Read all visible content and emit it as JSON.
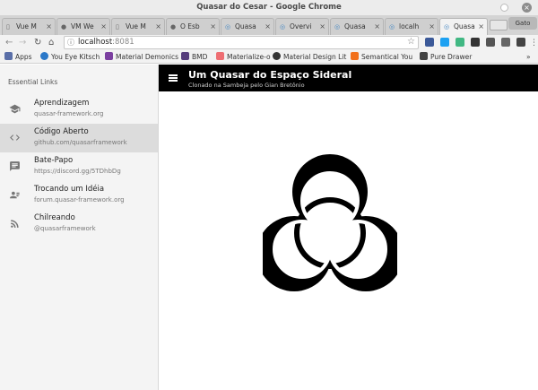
{
  "window": {
    "title": "Quasar do Cesar - Google Chrome",
    "close_glyph": "×"
  },
  "tabs": [
    {
      "label": "Vue M",
      "icon": "page-icon",
      "active": false
    },
    {
      "label": "VM We",
      "icon": "github-icon",
      "active": false
    },
    {
      "label": "Vue M",
      "icon": "page-icon",
      "active": false
    },
    {
      "label": "O Esb",
      "icon": "github-icon",
      "active": false
    },
    {
      "label": "Quasa",
      "icon": "quasar-icon",
      "active": false
    },
    {
      "label": "Overvi",
      "icon": "quasar-icon",
      "active": false
    },
    {
      "label": "Quasa",
      "icon": "quasar-icon",
      "active": false
    },
    {
      "label": "localh",
      "icon": "quasar-icon",
      "active": false
    },
    {
      "label": "Quasa",
      "icon": "quasar-icon",
      "active": true
    }
  ],
  "tab_close_glyph": "×",
  "profile_label": "Gato",
  "toolbar": {
    "back_glyph": "←",
    "forward_glyph": "→",
    "reload_glyph": "↻",
    "home_glyph": "⌂",
    "info_glyph": "ⓘ",
    "star_glyph": "☆",
    "url_host": "localhost",
    "url_port": ":8081"
  },
  "bookmarks": [
    {
      "label": "Apps",
      "color": "#5a6fa8"
    },
    {
      "label": "You Eye Kitsch",
      "color": "#2a78c8"
    },
    {
      "label": "Material Demonics",
      "color": "#7b3fa0"
    },
    {
      "label": "BMD",
      "color": "#563d7c"
    },
    {
      "label": "Materialize-o",
      "color": "#ee6e73"
    },
    {
      "label": "Material Design Lit",
      "color": "#333333"
    },
    {
      "label": "Semantical You",
      "color": "#f2711c"
    },
    {
      "label": "Pure Drawer",
      "color": "#444444"
    }
  ],
  "bookmarks_overflow": "»",
  "drawer": {
    "header": "Essential Links",
    "items": [
      {
        "label": "Aprendizagem",
        "sub": "quasar-framework.org",
        "icon": "school-icon",
        "active": false
      },
      {
        "label": "Código Aberto",
        "sub": "github.com/quasarframework",
        "icon": "code-icon",
        "active": true
      },
      {
        "label": "Bate-Papo",
        "sub": "https://discord.gg/5TDhbDg",
        "icon": "chat-icon",
        "active": false
      },
      {
        "label": "Trocando um Idéia",
        "sub": "forum.quasar-framework.org",
        "icon": "forum-icon",
        "active": false
      },
      {
        "label": "Chilreando",
        "sub": "@quasarframework",
        "icon": "rss-icon",
        "active": false
      }
    ]
  },
  "appbar": {
    "title": "Um Quasar do Espaço Sideral",
    "subtitle": "Clonado na Sambeja pelo Gian Bretônio",
    "background": "#000000"
  },
  "main": {
    "image": "biohazard-icon"
  }
}
